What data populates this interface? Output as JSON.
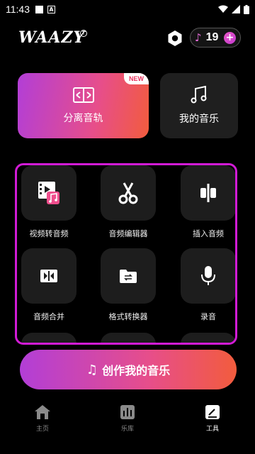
{
  "status_bar": {
    "time": "11:43"
  },
  "header": {
    "logo": "WAAZY",
    "info_glyph": "i",
    "credits": "19",
    "plus_glyph": "+"
  },
  "cards": {
    "separate": {
      "label": "分离音轨",
      "badge": "NEW"
    },
    "my_music": {
      "label": "我的音乐"
    }
  },
  "tools": [
    {
      "label": "视频转音频",
      "icon": "video-to-audio-icon"
    },
    {
      "label": "音频编辑器",
      "icon": "scissors-icon"
    },
    {
      "label": "插入音频",
      "icon": "insert-audio-icon"
    },
    {
      "label": "音频合并",
      "icon": "merge-icon"
    },
    {
      "label": "格式转换器",
      "icon": "folder-convert-icon"
    },
    {
      "label": "录音",
      "icon": "microphone-icon"
    }
  ],
  "create_button": {
    "label": "创作我的音乐",
    "glyph": "♫"
  },
  "nav": [
    {
      "label": "主页",
      "icon": "home-icon",
      "active": false
    },
    {
      "label": "乐库",
      "icon": "library-icon",
      "active": false
    },
    {
      "label": "工具",
      "icon": "tools-icon",
      "active": true
    }
  ],
  "colors": {
    "accent_gradient_start": "#b23ed7",
    "accent_gradient_end": "#f25c3d",
    "panel_border": "#d21bd6"
  }
}
